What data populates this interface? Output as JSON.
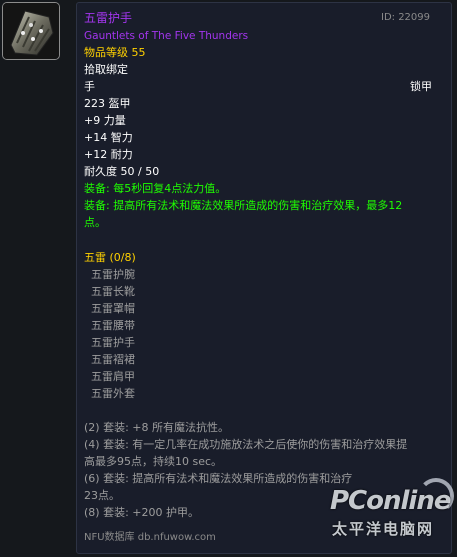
{
  "item": {
    "name": "五雷护手",
    "english_name": "Gauntlets of The Five Thunders",
    "id_text": "ID: 22099",
    "item_level": "物品等级 55",
    "bind": "拾取绑定",
    "slot": "手",
    "armor_type": "锁甲",
    "armor": "223 盔甲",
    "stats": [
      "+9 力量",
      "+14 智力",
      "+12 耐力"
    ],
    "durability": "耐久度 50 / 50",
    "equip_effects": [
      {
        "label": "装备:",
        "text": " 每5秒回复4点法力值。"
      },
      {
        "label": "装备:",
        "text": " 提高所有法术和魔法效果所造成的伤害和治疗效果，最多12"
      },
      {
        "label": "",
        "text": "点。"
      }
    ]
  },
  "set": {
    "title": "五雷 (0/8)",
    "items": [
      "五雷护腕",
      "五雷长靴",
      "五雷罩帽",
      "五雷腰带",
      "五雷护手",
      "五雷褶裙",
      "五雷肩甲",
      "五雷外套"
    ],
    "bonuses": [
      "(2) 套装: +8 所有魔法抗性。",
      "(4) 套装: 有一定几率在成功施放法术之后使你的伤害和治疗效果提",
      "高最多95点，持续10 sec。",
      "(6) 套装: 提高所有法术和魔法效果所造成的伤害和治疗",
      "23点。",
      "(8) 套装: +200 护甲。"
    ]
  },
  "footer": "NFU数据库 db.nfuwow.com",
  "watermark": {
    "main": "PConline",
    "sub": "太平洋电脑网"
  },
  "icon": {
    "name": "gauntlet-icon"
  },
  "colors": {
    "epic": "#a335ee",
    "item_level": "#ffd100",
    "equip": "#1eff00",
    "set_title": "#ffd100",
    "inactive": "#9d9d9d",
    "background": "#191d2a"
  }
}
